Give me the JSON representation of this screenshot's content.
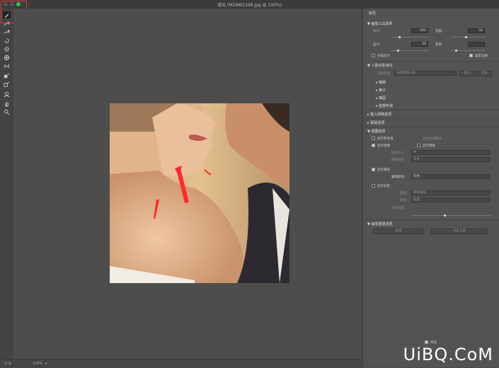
{
  "window": {
    "title": "液化 (MZAW2349.jpg @ 100%)"
  },
  "status": {
    "zoom": "100%"
  },
  "panel": {
    "title": "属性",
    "brush_section": "画笔工具选项",
    "brush": {
      "size_label": "大小:",
      "size_value": "200",
      "density_label": "浓度:",
      "density_value": "50",
      "pressure_label": "压力:",
      "pressure_value": "20",
      "rate_label": "速率:",
      "rate_value": "",
      "stylus_label": "光笔压力",
      "pin_edges_label": "固定边缘"
    },
    "face_section": "人脸识别液化",
    "face": {
      "select_label": "选择脸部:",
      "select_value": "未检测到人脸",
      "reset_label": "复位",
      "all_label": "全部",
      "items": [
        "眼睛",
        "鼻子",
        "嘴唇",
        "脸部形状"
      ]
    },
    "load_section": "载入网格选项",
    "mask_section": "蒙版选项",
    "view_section": "视图选项",
    "view": {
      "guides_label": "显示参考线",
      "face_overlay_label": "显示脸部叠加",
      "show_image_label": "显示图像",
      "show_mesh_label": "显示网格",
      "mesh_size_label": "网格大小:",
      "mesh_size_value": "中",
      "mesh_color_label": "网格颜色:",
      "mesh_color_value": "灰色",
      "show_mask_label": "显示蒙版",
      "mask_color_label": "蒙版颜色:",
      "mask_color_value": "红色",
      "show_backdrop_label": "显示背景",
      "use_label": "使用:",
      "use_value": "所有图层",
      "mode_label": "模式:",
      "mode_value": "前面",
      "opacity_label": "不透明度:"
    },
    "rebuild_section": "画笔重建选项",
    "rebuild": {
      "rebuild_label": "重建",
      "restore_all_label": "恢复全部"
    },
    "preview_label": "预览"
  },
  "watermark": "UiBQ.CoM",
  "icons": {
    "tools": [
      "forward-warp-icon",
      "reconstruct-icon",
      "smooth-icon",
      "twirl-icon",
      "pucker-icon",
      "bloat-icon",
      "push-left-icon",
      "freeze-mask-icon",
      "thaw-mask-icon",
      "face-tool-icon",
      "hand-icon",
      "zoom-icon"
    ]
  },
  "colors": {
    "accent_red": "#e23a3a",
    "annotation_red": "#ff2a2a"
  }
}
